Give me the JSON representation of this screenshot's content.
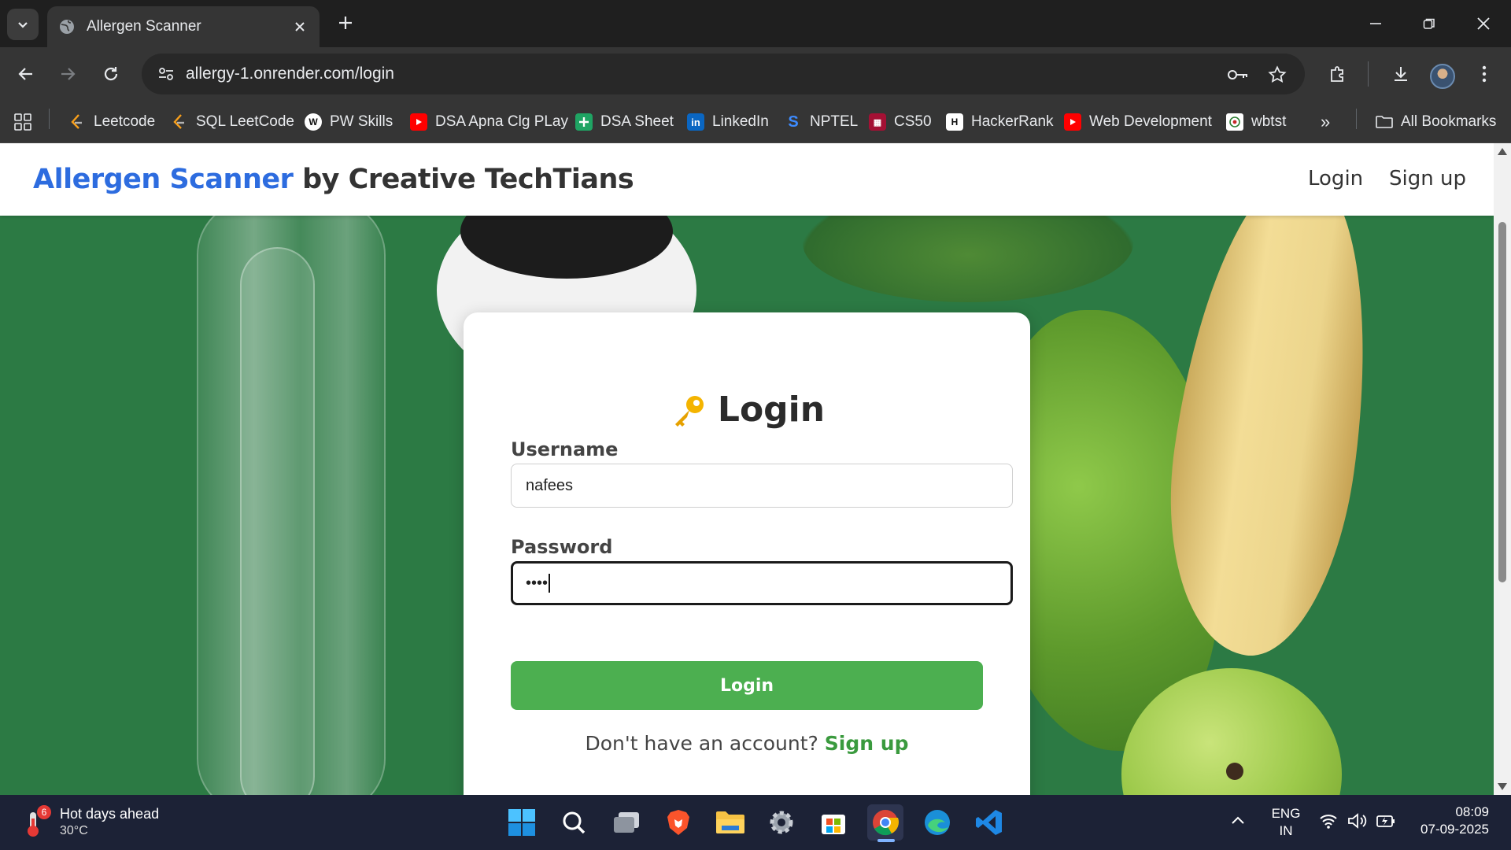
{
  "browser": {
    "tab_title": "Allergen Scanner",
    "url": "allergy-1.onrender.com/login",
    "bookmarks": [
      {
        "label": "Leetcode",
        "icon": "leetcode-icon"
      },
      {
        "label": "SQL LeetCode",
        "icon": "leetcode-icon"
      },
      {
        "label": "PW Skills",
        "icon": "pwskills-icon"
      },
      {
        "label": "DSA Apna Clg PLay",
        "icon": "youtube-icon"
      },
      {
        "label": "DSA Sheet",
        "icon": "sheets-icon"
      },
      {
        "label": "LinkedIn",
        "icon": "linkedin-icon"
      },
      {
        "label": "NPTEL",
        "icon": "nptel-icon"
      },
      {
        "label": "CS50",
        "icon": "harvard-icon"
      },
      {
        "label": "HackerRank",
        "icon": "hackerrank-icon"
      },
      {
        "label": "Web Development",
        "icon": "youtube-icon"
      },
      {
        "label": "wbtst",
        "icon": "wbtst-icon"
      }
    ],
    "all_bookmarks_label": "All Bookmarks",
    "overflow_label": "»"
  },
  "site": {
    "brand_accent": "Allergen Scanner",
    "brand_rest": " by Creative TechTians",
    "nav": {
      "login": "Login",
      "signup": "Sign up"
    },
    "colors": {
      "accent_blue": "#2d6cdf",
      "button_green": "#4caf50",
      "link_green": "#3a9a3e",
      "hero_green": "#2c7a44"
    }
  },
  "login_form": {
    "title": "Login",
    "title_icon": "key-icon",
    "username_label": "Username",
    "username_value": "nafees",
    "password_label": "Password",
    "password_value": "••••",
    "submit_label": "Login",
    "prompt_text": "Don't have an account?",
    "signup_link": "Sign up"
  },
  "taskbar": {
    "weather_badge": "6",
    "weather_title": "Hot days ahead",
    "weather_temp": "30°C",
    "lang_line1": "ENG",
    "lang_line2": "IN",
    "time": "08:09",
    "date": "07-09-2025"
  }
}
